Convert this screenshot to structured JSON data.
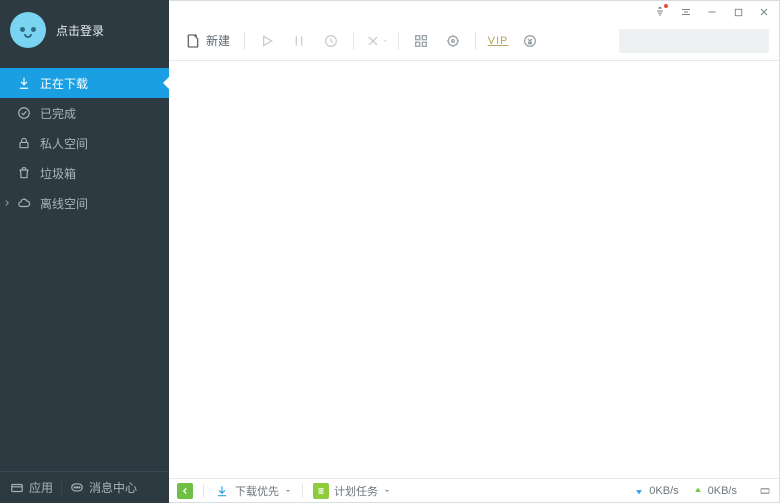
{
  "sidebar": {
    "login_label": "点击登录",
    "nav": [
      {
        "label": "正在下载",
        "icon": "download-icon",
        "active": true
      },
      {
        "label": "已完成",
        "icon": "check-circle-icon",
        "active": false
      },
      {
        "label": "私人空间",
        "icon": "lock-icon",
        "active": false
      },
      {
        "label": "垃圾箱",
        "icon": "trash-icon",
        "active": false
      },
      {
        "label": "离线空间",
        "icon": "cloud-icon",
        "active": false,
        "expandable": true
      }
    ],
    "footer": {
      "apps_label": "应用",
      "messages_label": "消息中心"
    }
  },
  "toolbar": {
    "new_label": "新建",
    "vip_label": "VIP",
    "search_value": ""
  },
  "statusbar": {
    "priority_label": "下载优先",
    "scheduled_label": "计划任务",
    "down_speed": "0KB/s",
    "up_speed": "0KB/s"
  }
}
